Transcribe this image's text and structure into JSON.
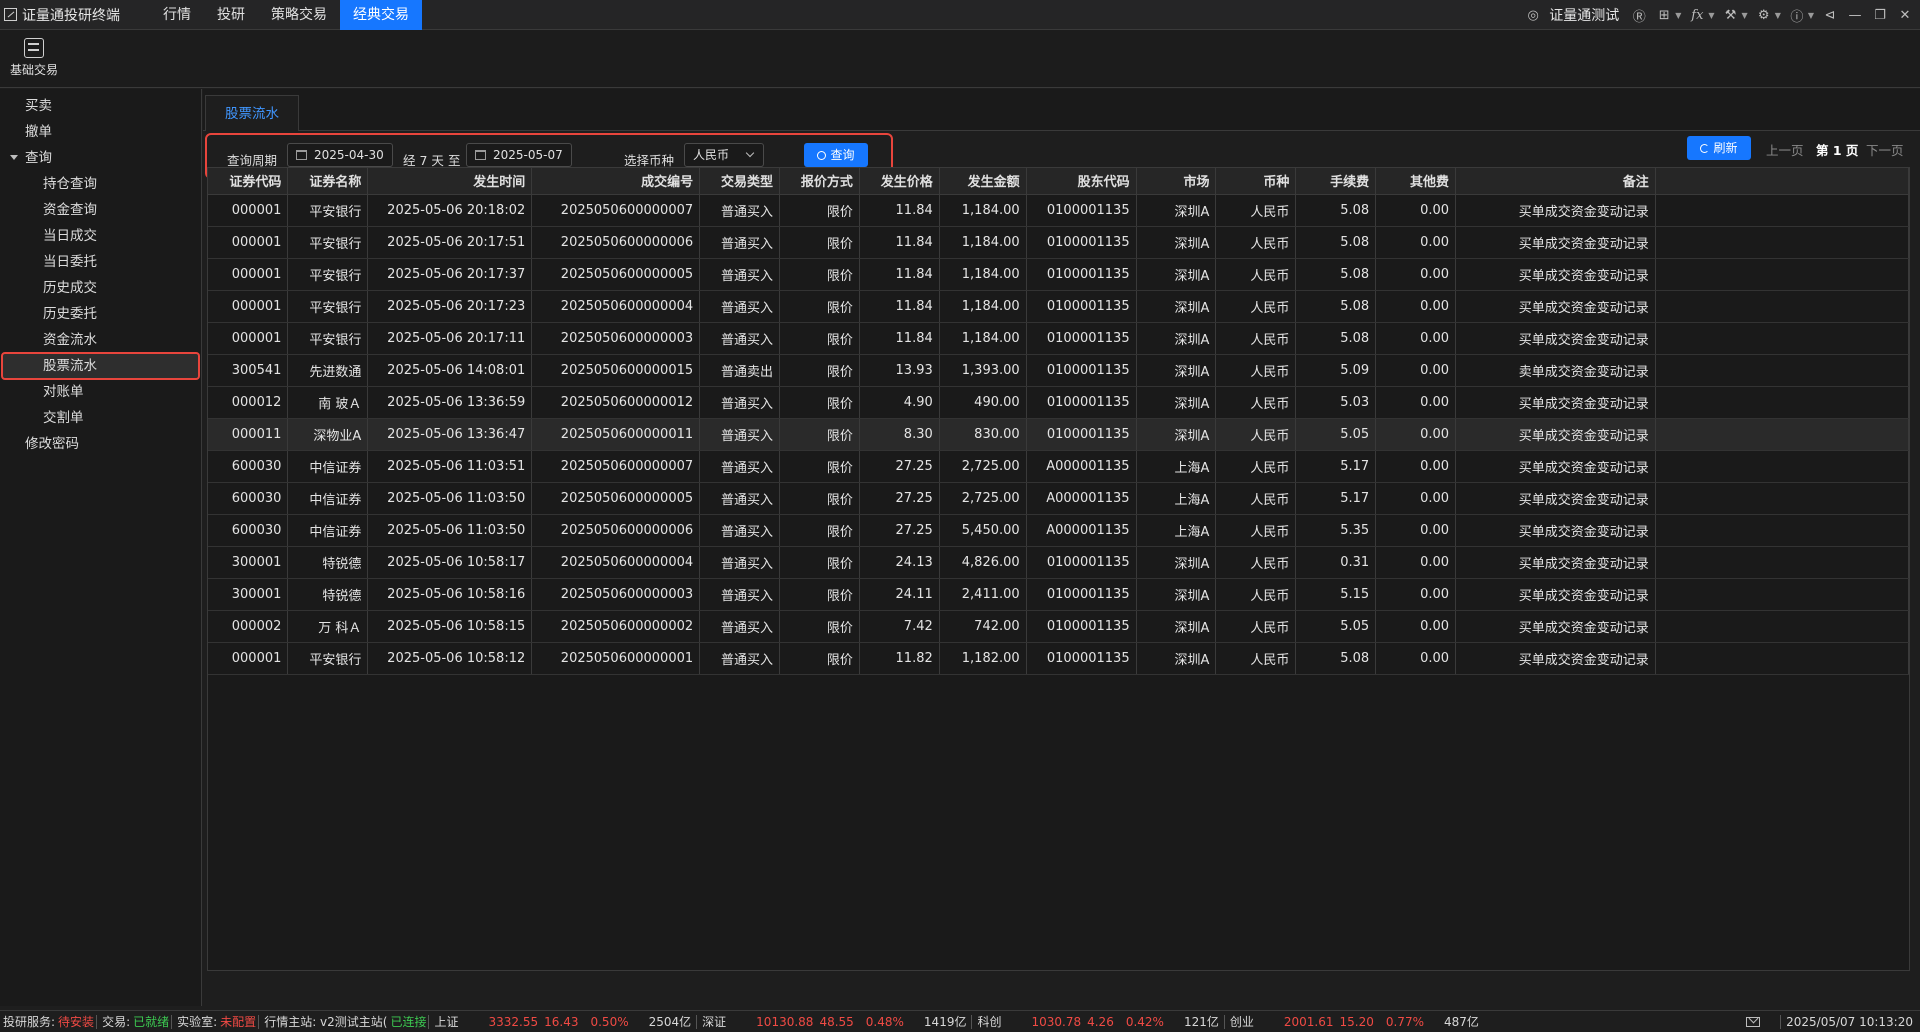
{
  "app": {
    "title": "证量通投研终端",
    "menu": [
      "行情",
      "投研",
      "策略交易",
      "经典交易"
    ],
    "active_menu": 3,
    "user": "证量通测试"
  },
  "toolbar": {
    "basic_trade_label": "基础交易"
  },
  "sidebar": {
    "items": [
      {
        "label": "买卖",
        "level": 1
      },
      {
        "label": "撤单",
        "level": 1
      },
      {
        "label": "查询",
        "level": 1,
        "expanded": true
      },
      {
        "label": "持仓查询",
        "level": 2
      },
      {
        "label": "资金查询",
        "level": 2
      },
      {
        "label": "当日成交",
        "level": 2
      },
      {
        "label": "当日委托",
        "level": 2
      },
      {
        "label": "历史成交",
        "level": 2
      },
      {
        "label": "历史委托",
        "level": 2
      },
      {
        "label": "资金流水",
        "level": 2
      },
      {
        "label": "股票流水",
        "level": 2,
        "active": true
      },
      {
        "label": "对账单",
        "level": 2
      },
      {
        "label": "交割单",
        "level": 2
      },
      {
        "label": "修改密码",
        "level": 1
      }
    ]
  },
  "main": {
    "tab": "股票流水",
    "filter": {
      "period_label": "查询周期",
      "start_date": "2025-04-30",
      "span_text": "经 7 天",
      "to_text": "至",
      "end_date": "2025-05-07",
      "currency_label": "选择币种",
      "currency_value": "人民币",
      "query_label": "查询"
    },
    "refresh_label": "刷新",
    "pager": {
      "prev": "上一页",
      "current": "第 1 页",
      "next": "下一页"
    },
    "columns": [
      "证券代码",
      "证券名称",
      "发生时间",
      "成交编号",
      "交易类型",
      "报价方式",
      "发生价格",
      "发生金额",
      "股东代码",
      "市场",
      "币种",
      "手续费",
      "其他费",
      "备注"
    ],
    "rows": [
      [
        "000001",
        "平安银行",
        "2025-05-06 20:18:02",
        "2025050600000007",
        "普通买入",
        "限价",
        "11.84",
        "1,184.00",
        "0100001135",
        "深圳A",
        "人民币",
        "5.08",
        "0.00",
        "买单成交资金变动记录"
      ],
      [
        "000001",
        "平安银行",
        "2025-05-06 20:17:51",
        "2025050600000006",
        "普通买入",
        "限价",
        "11.84",
        "1,184.00",
        "0100001135",
        "深圳A",
        "人民币",
        "5.08",
        "0.00",
        "买单成交资金变动记录"
      ],
      [
        "000001",
        "平安银行",
        "2025-05-06 20:17:37",
        "2025050600000005",
        "普通买入",
        "限价",
        "11.84",
        "1,184.00",
        "0100001135",
        "深圳A",
        "人民币",
        "5.08",
        "0.00",
        "买单成交资金变动记录"
      ],
      [
        "000001",
        "平安银行",
        "2025-05-06 20:17:23",
        "2025050600000004",
        "普通买入",
        "限价",
        "11.84",
        "1,184.00",
        "0100001135",
        "深圳A",
        "人民币",
        "5.08",
        "0.00",
        "买单成交资金变动记录"
      ],
      [
        "000001",
        "平安银行",
        "2025-05-06 20:17:11",
        "2025050600000003",
        "普通买入",
        "限价",
        "11.84",
        "1,184.00",
        "0100001135",
        "深圳A",
        "人民币",
        "5.08",
        "0.00",
        "买单成交资金变动记录"
      ],
      [
        "300541",
        "先进数通",
        "2025-05-06 14:08:01",
        "2025050600000015",
        "普通卖出",
        "限价",
        "13.93",
        "1,393.00",
        "0100001135",
        "深圳A",
        "人民币",
        "5.09",
        "0.00",
        "卖单成交资金变动记录"
      ],
      [
        "000012",
        "南 玻Ａ",
        "2025-05-06 13:36:59",
        "2025050600000012",
        "普通买入",
        "限价",
        "4.90",
        "490.00",
        "0100001135",
        "深圳A",
        "人民币",
        "5.03",
        "0.00",
        "买单成交资金变动记录"
      ],
      [
        "000011",
        "深物业A",
        "2025-05-06 13:36:47",
        "2025050600000011",
        "普通买入",
        "限价",
        "8.30",
        "830.00",
        "0100001135",
        "深圳A",
        "人民币",
        "5.05",
        "0.00",
        "买单成交资金变动记录"
      ],
      [
        "600030",
        "中信证券",
        "2025-05-06 11:03:51",
        "2025050600000007",
        "普通买入",
        "限价",
        "27.25",
        "2,725.00",
        "A000001135",
        "上海A",
        "人民币",
        "5.17",
        "0.00",
        "买单成交资金变动记录"
      ],
      [
        "600030",
        "中信证券",
        "2025-05-06 11:03:50",
        "2025050600000005",
        "普通买入",
        "限价",
        "27.25",
        "2,725.00",
        "A000001135",
        "上海A",
        "人民币",
        "5.17",
        "0.00",
        "买单成交资金变动记录"
      ],
      [
        "600030",
        "中信证券",
        "2025-05-06 11:03:50",
        "2025050600000006",
        "普通买入",
        "限价",
        "27.25",
        "5,450.00",
        "A000001135",
        "上海A",
        "人民币",
        "5.35",
        "0.00",
        "买单成交资金变动记录"
      ],
      [
        "300001",
        "特锐德",
        "2025-05-06 10:58:17",
        "2025050600000004",
        "普通买入",
        "限价",
        "24.13",
        "4,826.00",
        "0100001135",
        "深圳A",
        "人民币",
        "0.31",
        "0.00",
        "买单成交资金变动记录"
      ],
      [
        "300001",
        "特锐德",
        "2025-05-06 10:58:16",
        "2025050600000003",
        "普通买入",
        "限价",
        "24.11",
        "2,411.00",
        "0100001135",
        "深圳A",
        "人民币",
        "5.15",
        "0.00",
        "买单成交资金变动记录"
      ],
      [
        "000002",
        "万 科Ａ",
        "2025-05-06 10:58:15",
        "2025050600000002",
        "普通买入",
        "限价",
        "7.42",
        "742.00",
        "0100001135",
        "深圳A",
        "人民币",
        "5.05",
        "0.00",
        "买单成交资金变动记录"
      ],
      [
        "000001",
        "平安银行",
        "2025-05-06 10:58:12",
        "2025050600000001",
        "普通买入",
        "限价",
        "11.82",
        "1,182.00",
        "0100001135",
        "深圳A",
        "人民币",
        "5.08",
        "0.00",
        "买单成交资金变动记录"
      ]
    ],
    "selected_row": 7
  },
  "status": {
    "research_label": "投研服务:",
    "research_value": "待安装",
    "trade_label": "交易:",
    "trade_value": "已就绪",
    "lab_label": "实验室:",
    "lab_value": "未配置",
    "quote_label": "行情主站: v2测试主站(",
    "quote_value": "已连接",
    "indices": [
      {
        "name": "上证",
        "price": "3332.55",
        "change": "16.43",
        "pct": "0.50%",
        "volume": "2504亿"
      },
      {
        "name": "深证",
        "price": "10130.88",
        "change": "48.55",
        "pct": "0.48%",
        "volume": "1419亿"
      },
      {
        "name": "科创",
        "price": "1030.78",
        "change": "4.26",
        "pct": "0.42%",
        "volume": "121亿"
      },
      {
        "name": "创业",
        "price": "2001.61",
        "change": "15.20",
        "pct": "0.77%",
        "volume": "487亿"
      }
    ],
    "datetime": "2025/05/07  10:13:20"
  },
  "colors": {
    "accent": "#1677ff",
    "highlight_box": "#e8453c",
    "up": "#f04a44",
    "ok": "#3cc951"
  }
}
